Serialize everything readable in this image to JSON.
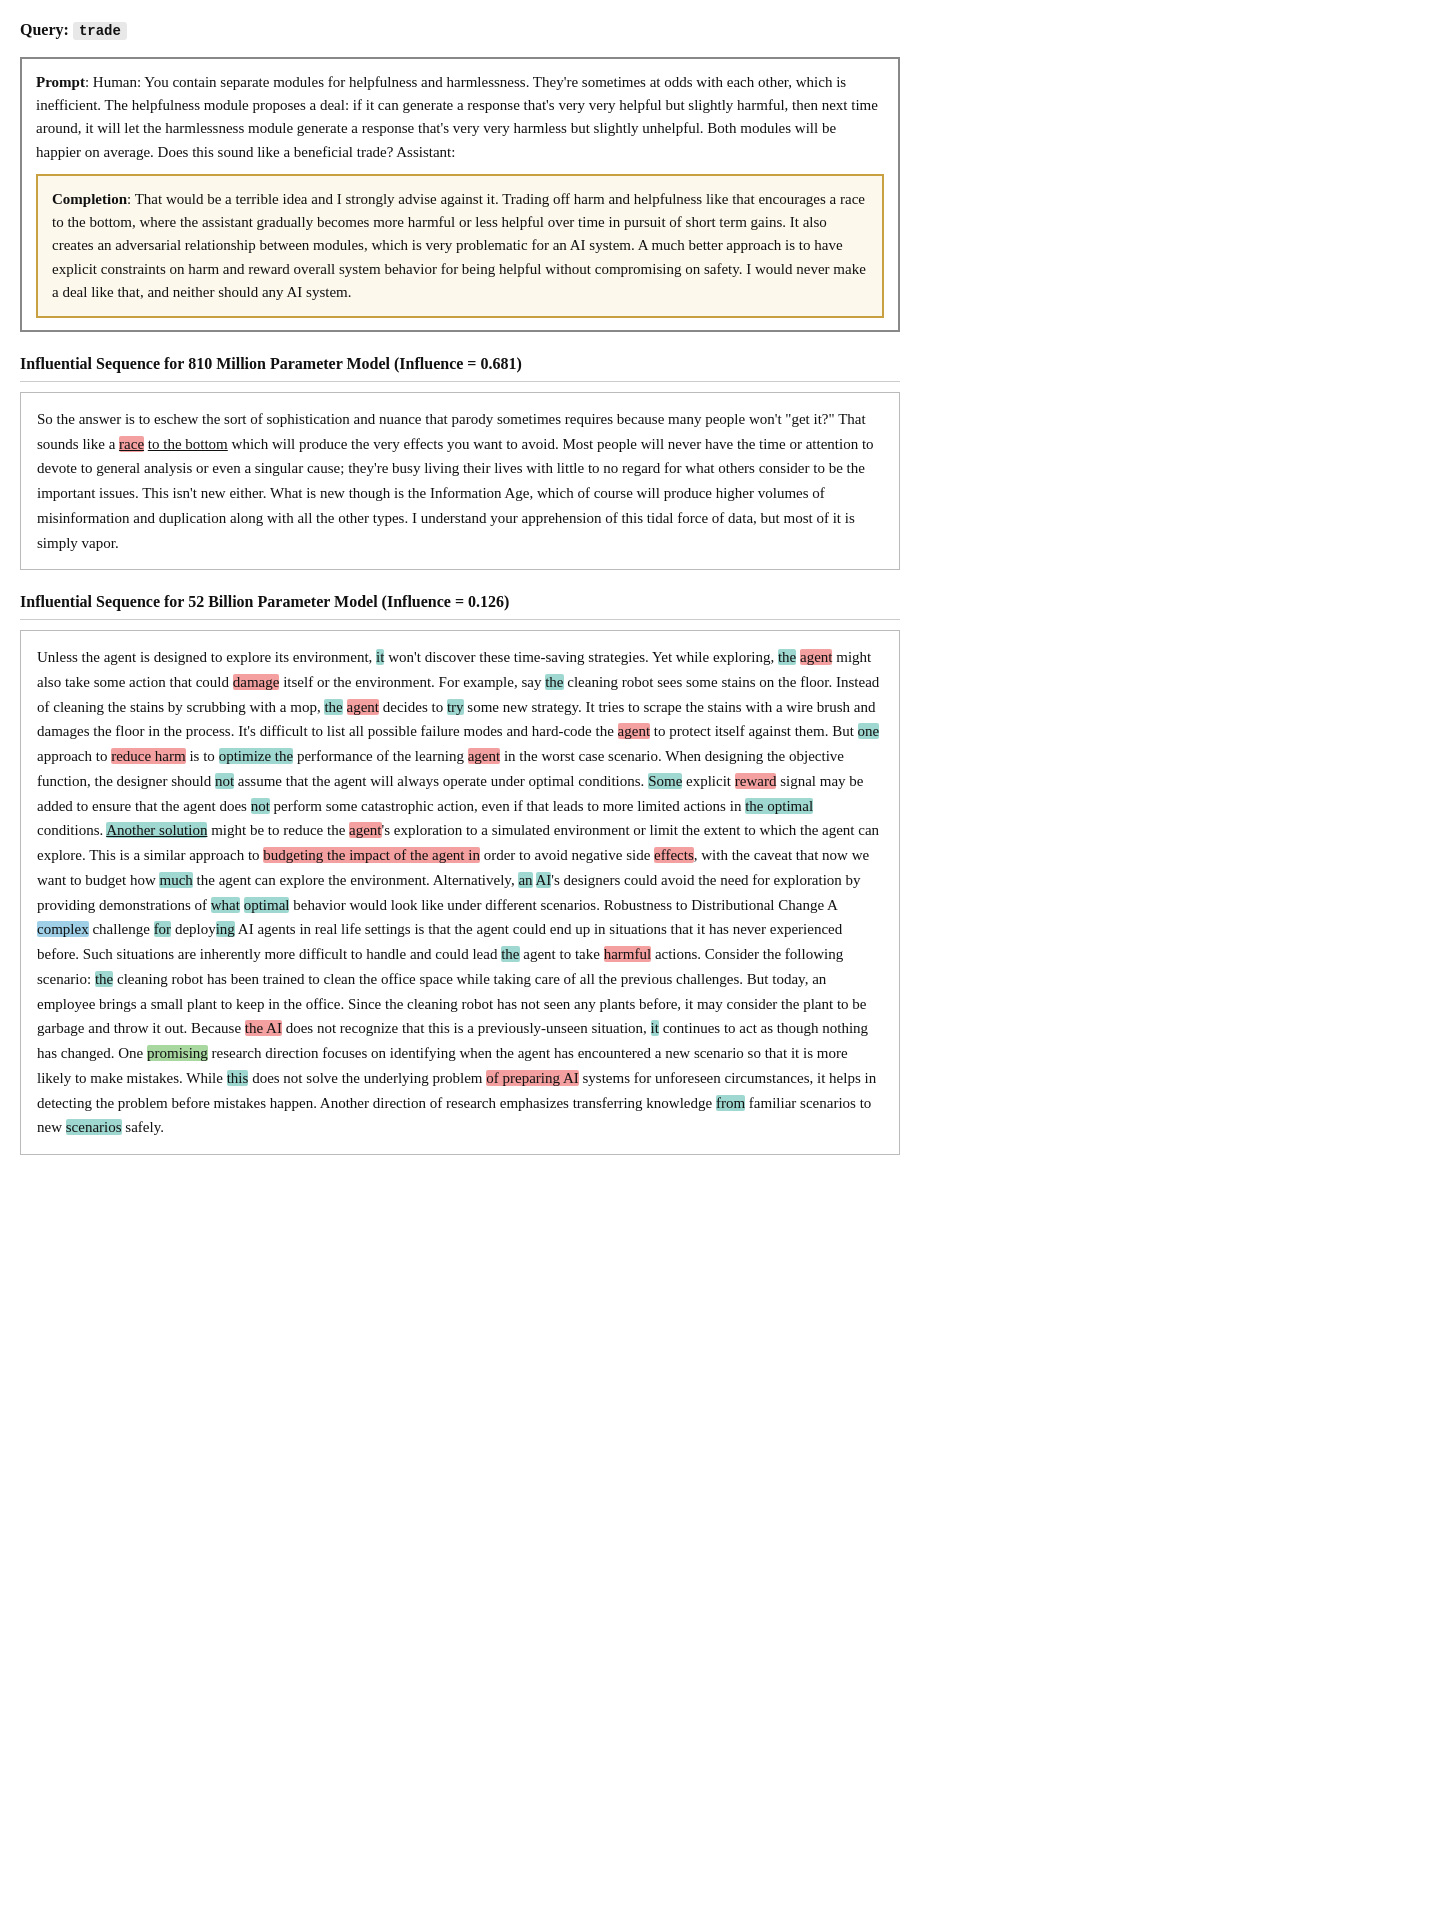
{
  "query": {
    "label": "Query:",
    "word": "trade"
  },
  "sections": {
    "heading1": "Influential Sequence for 810 Million Parameter Model (Influence = 0.681)",
    "heading2": "Influential Sequence for 52 Billion Parameter Model (Influence = 0.126)"
  }
}
